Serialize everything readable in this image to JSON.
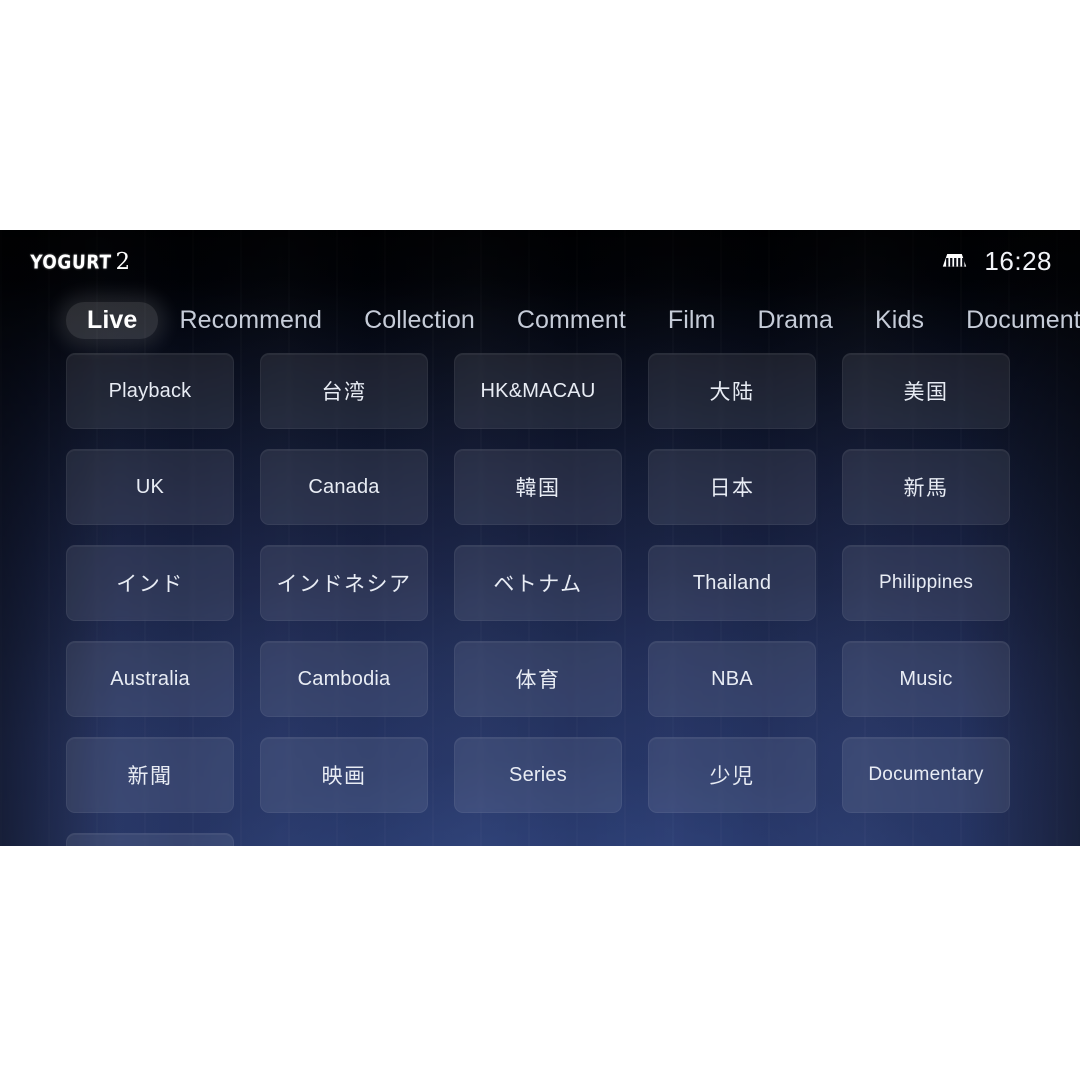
{
  "app": {
    "brand_word": "YOGURT",
    "brand_number": "2"
  },
  "status_bar": {
    "network_icon": "ethernet-icon",
    "time": "16:28"
  },
  "nav": {
    "tabs": [
      {
        "label": "Live",
        "active": true
      },
      {
        "label": "Recommend",
        "active": false
      },
      {
        "label": "Collection",
        "active": false
      },
      {
        "label": "Comment",
        "active": false
      },
      {
        "label": "Film",
        "active": false
      },
      {
        "label": "Drama",
        "active": false
      },
      {
        "label": "Kids",
        "active": false
      },
      {
        "label": "Documentary",
        "active": false
      }
    ]
  },
  "grid": {
    "columns": 5,
    "tiles": [
      {
        "label": "Playback",
        "cjk": false
      },
      {
        "label": "台湾",
        "cjk": true
      },
      {
        "label": "HK&MACAU",
        "cjk": false
      },
      {
        "label": "大陆",
        "cjk": true
      },
      {
        "label": "美国",
        "cjk": true
      },
      {
        "label": "UK",
        "cjk": false
      },
      {
        "label": "Canada",
        "cjk": false
      },
      {
        "label": "韓国",
        "cjk": true
      },
      {
        "label": "日本",
        "cjk": true
      },
      {
        "label": "新馬",
        "cjk": true
      },
      {
        "label": "インド",
        "cjk": true
      },
      {
        "label": "インドネシア",
        "cjk": true
      },
      {
        "label": "ベトナム",
        "cjk": true
      },
      {
        "label": "Thailand",
        "cjk": false
      },
      {
        "label": "Philippines",
        "cjk": false
      },
      {
        "label": "Australia",
        "cjk": false
      },
      {
        "label": "Cambodia",
        "cjk": false
      },
      {
        "label": "体育",
        "cjk": true
      },
      {
        "label": "NBA",
        "cjk": false
      },
      {
        "label": "Music",
        "cjk": false
      },
      {
        "label": "新聞",
        "cjk": true
      },
      {
        "label": "映画",
        "cjk": true
      },
      {
        "label": "Series",
        "cjk": false
      },
      {
        "label": "少児",
        "cjk": true
      },
      {
        "label": "Documentary",
        "cjk": false
      },
      {
        "label": "",
        "cjk": false
      }
    ]
  },
  "colors": {
    "page_background": "#ffffff",
    "frame_top": "#000104",
    "frame_bottom": "#2b3866",
    "tile_fill": "rgba(255,255,255,0.085)",
    "text_primary": "#ffffff",
    "text_secondary": "#c6ccd8",
    "active_tab_pill": "rgba(255,255,255,0.16)"
  }
}
